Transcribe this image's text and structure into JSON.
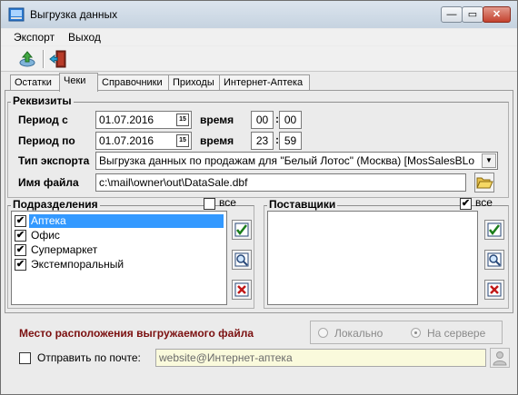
{
  "window": {
    "title": "Выгрузка данных",
    "min": "—",
    "max": "▭",
    "close": "✕"
  },
  "menu": {
    "items": [
      "Экспорт",
      "Выход"
    ]
  },
  "toolbar": {
    "export_icon": "export-icon",
    "exit_icon": "exit-door-icon"
  },
  "tabs": [
    {
      "label": "Остатки"
    },
    {
      "label": "Чеки"
    },
    {
      "label": "Справочники"
    },
    {
      "label": "Приходы"
    },
    {
      "label": "Интернет-Аптека"
    }
  ],
  "requisites": {
    "title": "Реквизиты",
    "period_from_label": "Период с",
    "period_from_date": "01.07.2016",
    "period_to_label": "Период по",
    "period_to_date": "01.07.2016",
    "time_label": "время",
    "from_hour": "00",
    "from_min": "00",
    "to_hour": "23",
    "to_min": "59",
    "calendar_glyph": "15",
    "export_type_label": "Тип экспорта",
    "export_type_value": "Выгрузка данных по продажам для \"Белый Лотос\" (Москва) [MosSalesBLo",
    "filename_label": "Имя файла",
    "filename_value": "c:\\mail\\owner\\out\\DataSale.dbf"
  },
  "departments": {
    "title": "Подразделения",
    "all_label": "все",
    "all_checked": false,
    "items": [
      {
        "label": "Аптека",
        "checked": true,
        "selected": true
      },
      {
        "label": "Офис",
        "checked": true,
        "selected": false
      },
      {
        "label": "Супермаркет",
        "checked": true,
        "selected": false
      },
      {
        "label": "Экстемпоральный",
        "checked": true,
        "selected": false
      }
    ]
  },
  "suppliers": {
    "title": "Поставщики",
    "all_label": "все",
    "all_checked": true
  },
  "check_mark": "✔",
  "bottom": {
    "location_label": "Место расположения выгружаемого файла",
    "location_color": "#7b1010",
    "local_label": "Локально",
    "server_label": "На сервере",
    "send_mail_label": "Отправить по почте:",
    "send_mail_checked": false,
    "email_value": "website@Интернет-аптека"
  }
}
